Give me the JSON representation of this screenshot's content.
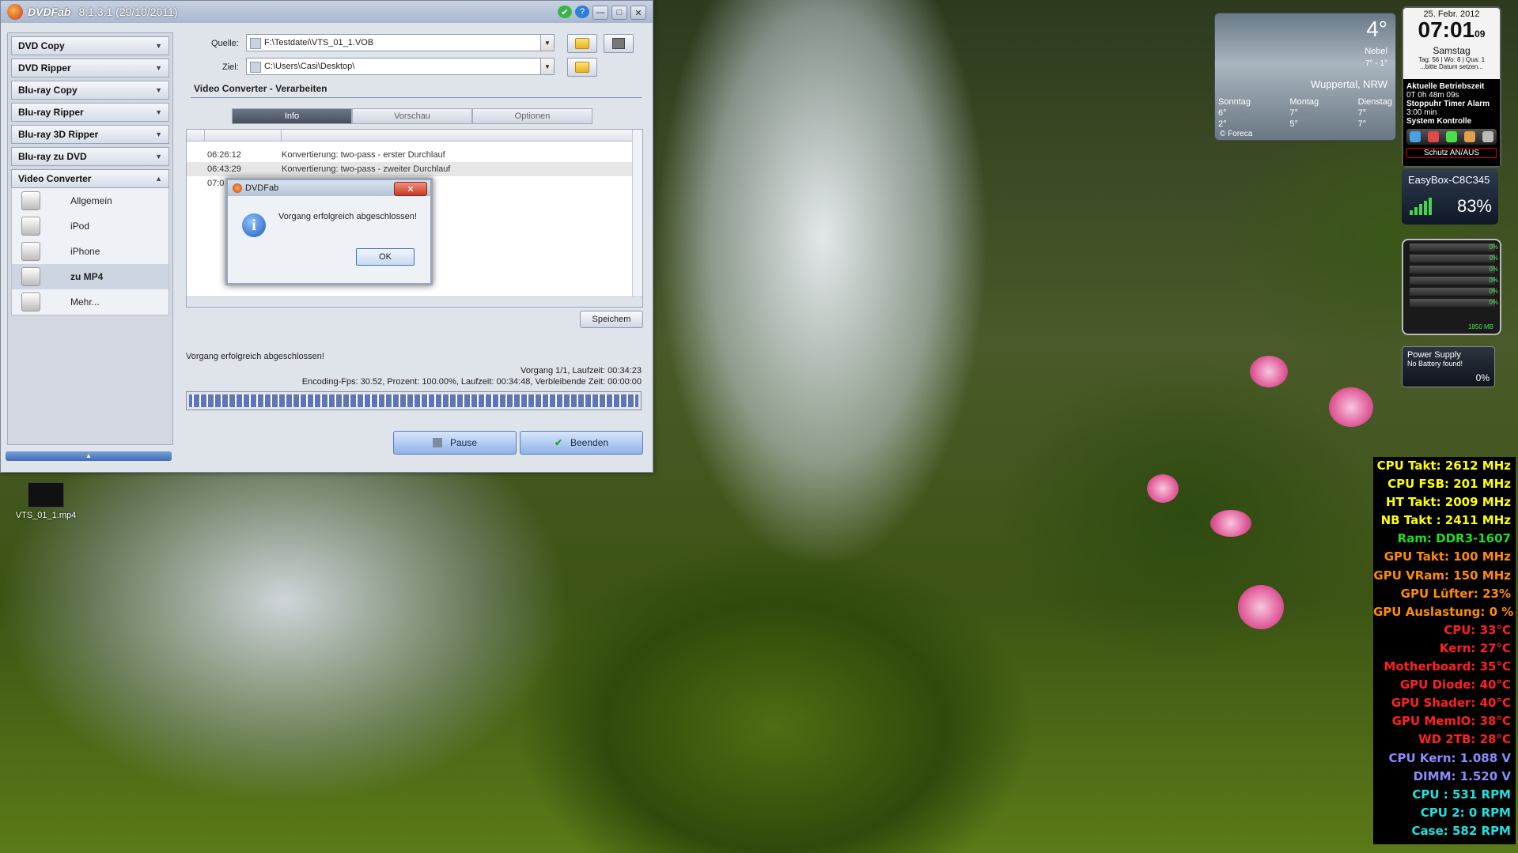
{
  "window": {
    "app_name": "DVDFab",
    "version": "8.1.3.1 (29/10/2011)",
    "controls": [
      "✔",
      "?",
      "—",
      "□",
      "✕"
    ]
  },
  "sidebar": {
    "items": [
      {
        "label": "DVD Copy"
      },
      {
        "label": "DVD Ripper"
      },
      {
        "label": "Blu-ray Copy"
      },
      {
        "label": "Blu-ray Ripper"
      },
      {
        "label": "Blu-ray 3D Ripper"
      },
      {
        "label": "Blu-ray zu DVD"
      },
      {
        "label": "Video Converter"
      }
    ],
    "sub": [
      "Allgemein",
      "iPod",
      "iPhone",
      "zu MP4",
      "Mehr..."
    ],
    "selected": "zu MP4"
  },
  "source": {
    "label": "Quelle:",
    "value": "F:\\Testdatei\\VTS_01_1.VOB"
  },
  "target": {
    "label": "Ziel:",
    "value": "C:\\Users\\Casi\\Desktop\\"
  },
  "section_title": "Video Converter  -  Verarbeiten",
  "tabs": [
    "Info",
    "Vorschau",
    "Optionen"
  ],
  "active_tab": "Info",
  "log": [
    {
      "time": "06:26:12",
      "msg": "Konvertierung: two-pass - erster Durchlauf"
    },
    {
      "time": "06:43:29",
      "msg": "Konvertierung: two-pass - zweiter Durchlauf"
    },
    {
      "time": "07:0",
      "msg": ""
    }
  ],
  "save_button": "Speichem",
  "status_text": "Vorgang erfolgreich abgeschlossen!",
  "progress_line1": "Vorgang 1/1, Laufzeit: 00:34:23",
  "progress_line2": "Encoding-Fps: 30.52,  Prozent: 100.00%,  Laufzeit: 00:34:48,  Verbleibende Zeit: 00:00:00",
  "progress_percent": 100,
  "buttons": {
    "pause": "Pause",
    "finish": "Beenden"
  },
  "dialog": {
    "title": "DVDFab",
    "message": "Vorgang erfolgreich abgeschlossen!",
    "ok": "OK",
    "close": "✕"
  },
  "desktop_icon": {
    "label": "VTS_01_1.mp4"
  },
  "weather": {
    "temp": "4°",
    "condition": "Nebel",
    "range": "7° - 1°",
    "city": "Wuppertal, NRW",
    "days": [
      {
        "name": "Sonntag",
        "hi": "6°",
        "lo": "2°"
      },
      {
        "name": "Montag",
        "hi": "7°",
        "lo": "5°"
      },
      {
        "name": "Dienstag",
        "hi": "7°",
        "lo": "7°"
      }
    ],
    "source": "© Foreca"
  },
  "clock": {
    "date": "25. Febr. 2012",
    "time": "07:01",
    "seconds": "09",
    "weekday": "Samstag",
    "info": "Tag: 56 | Wo: 8 | Qua: 1",
    "hint": "...bitte Datum setzen...",
    "uptime_label": "Aktuelle Betriebszeit",
    "uptime": "0T 0h 48m 09s",
    "timer_label": "Stoppuhr Timer Alarm",
    "timer": "3:00 min",
    "control_label": "System Kontrolle",
    "protect": "Schutz AN/AUS"
  },
  "wifi": {
    "name": "EasyBox-C8C345",
    "percent": "83%"
  },
  "cpu_meter": {
    "values": [
      "0%",
      "0%",
      "0%",
      "0%",
      "0%",
      "0%"
    ],
    "memory": "1850 MB"
  },
  "power": {
    "title": "Power Supply",
    "note": "No Battery found!",
    "percent": "0%"
  },
  "hardware": [
    {
      "text": "CPU Takt: 2612 MHz",
      "color": "#ffff00"
    },
    {
      "text": "CPU FSB: 201 MHz",
      "color": "#ffff00"
    },
    {
      "text": "HT Takt: 2009 MHz",
      "color": "#ffff00"
    },
    {
      "text": "NB Takt : 2411 MHz",
      "color": "#ffff00"
    },
    {
      "text": "Ram: DDR3-1607",
      "color": "#22dd22"
    },
    {
      "text": "GPU Takt: 100 MHz",
      "color": "#ff8c00"
    },
    {
      "text": "GPU VRam: 150 MHz",
      "color": "#ff8c00"
    },
    {
      "text": "GPU Lüfter: 23%",
      "color": "#ff8c00"
    },
    {
      "text": "GPU Auslastung: 0 %",
      "color": "#ff8c00"
    },
    {
      "text": "CPU: 33°C",
      "color": "#ff2020"
    },
    {
      "text": "Kern: 27°C",
      "color": "#ff2020"
    },
    {
      "text": "Motherboard: 35°C",
      "color": "#ff2020"
    },
    {
      "text": "GPU Diode: 40°C",
      "color": "#ff2020"
    },
    {
      "text": "GPU Shader: 40°C",
      "color": "#ff2020"
    },
    {
      "text": "GPU MemIO: 38°C",
      "color": "#ff2020"
    },
    {
      "text": "WD 2TB: 28°C",
      "color": "#ff2020"
    },
    {
      "text": "CPU Kern: 1.088 V",
      "color": "#8c8cff"
    },
    {
      "text": "DIMM: 1.520 V",
      "color": "#8c8cff"
    },
    {
      "text": "CPU : 531 RPM",
      "color": "#22e0e0"
    },
    {
      "text": "CPU 2: 0 RPM",
      "color": "#22e0e0"
    },
    {
      "text": "Case: 582 RPM",
      "color": "#22e0e0"
    }
  ]
}
